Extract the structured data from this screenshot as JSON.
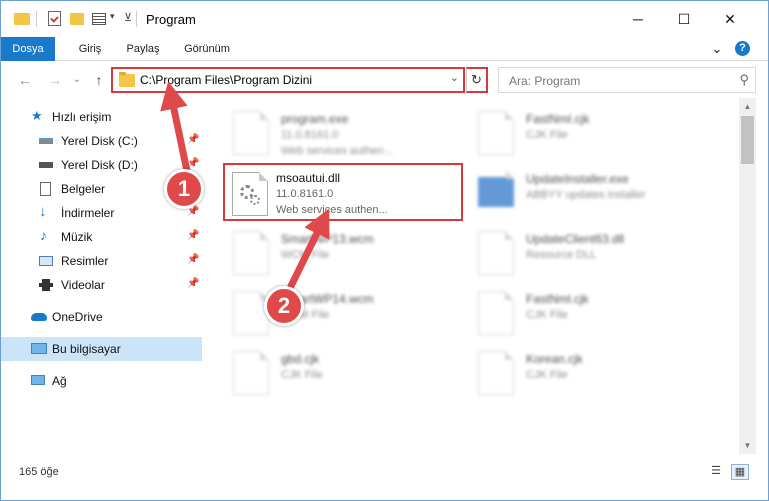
{
  "window": {
    "title": "Program",
    "controls": {
      "minimize": "─",
      "maximize": "☐",
      "close": "✕"
    }
  },
  "ribbon": {
    "tabs": [
      "Dosya",
      "Giriş",
      "Paylaş",
      "Görünüm"
    ],
    "expand": "⌄",
    "help": "?"
  },
  "address_bar": {
    "path": "C:\\Program Files\\Program Dizini",
    "dropdown": "⌄",
    "refresh": "↻"
  },
  "search": {
    "placeholder": "Ara: Program",
    "icon": "search-icon"
  },
  "nav": {
    "back": "←",
    "forward": "→",
    "recent": "⌄",
    "up": "↑"
  },
  "sidebar": {
    "items": [
      {
        "label": "Hızlı erişim",
        "icon": "star-icon"
      },
      {
        "label": "Yerel Disk (C:)",
        "icon": "drive-icon",
        "pinned": "📌"
      },
      {
        "label": "Yerel Disk (D:)",
        "icon": "drive-icon",
        "pinned": "📌"
      },
      {
        "label": "Belgeler",
        "icon": "document-icon",
        "pinned": "📌"
      },
      {
        "label": "İndirmeler",
        "icon": "download-icon",
        "pinned": "📌"
      },
      {
        "label": "Müzik",
        "icon": "music-icon",
        "pinned": "📌"
      },
      {
        "label": "Resimler",
        "icon": "pictures-icon",
        "pinned": "📌"
      },
      {
        "label": "Videolar",
        "icon": "video-icon",
        "pinned": "📌"
      },
      {
        "label": "OneDrive",
        "icon": "cloud-icon"
      },
      {
        "label": "Bu bilgisayar",
        "icon": "computer-icon"
      },
      {
        "label": "Ağ",
        "icon": "network-icon"
      }
    ]
  },
  "files": [
    {
      "name": "program.exe",
      "line2": "11.0.8161.0",
      "line3": "Web services authen...",
      "blurred": true
    },
    {
      "name": "FastNmI.cjk",
      "line2": "CJK File",
      "line3": "",
      "blurred": true
    },
    {
      "name": "msoautui.dll",
      "line2": "11.0.8161.0",
      "line3": "Web services authen...",
      "blurred": false
    },
    {
      "name": "UpdateInstaller.exe",
      "line2": "ABBYY updates installer",
      "line3": "",
      "blurred": true
    },
    {
      "name": "SmartWP13.wcm",
      "line2": "WCM File",
      "line3": "",
      "blurred": true
    },
    {
      "name": "UpdateClient63.dll",
      "line2": "Resource DLL",
      "line3": "",
      "blurred": true
    },
    {
      "name": "SmartWP14.wcm",
      "line2": "WCM File",
      "line3": "",
      "blurred": true
    },
    {
      "name": "FastNml.cjk",
      "line2": "CJK File",
      "line3": "",
      "blurred": true
    },
    {
      "name": "gbd.cjk",
      "line2": "CJK File",
      "line3": "",
      "blurred": true
    },
    {
      "name": "Korean.cjk",
      "line2": "CJK File",
      "line3": "",
      "blurred": true
    }
  ],
  "status": {
    "count": "165 öğe"
  },
  "annotations": {
    "marker1": "1",
    "marker2": "2"
  },
  "colors": {
    "accent": "#1979ca",
    "highlight": "#d9383a",
    "selected": "#cce4f7"
  }
}
